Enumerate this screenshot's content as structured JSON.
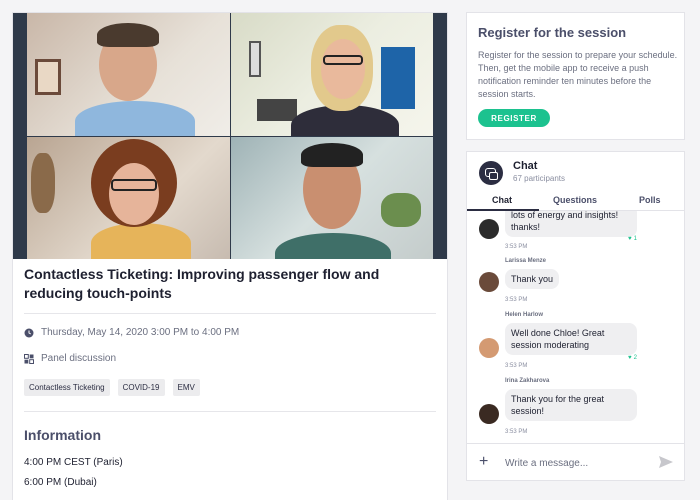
{
  "session": {
    "title": "Contactless Ticketing: Improving passenger flow and reducing touch-points",
    "date": "Thursday, May 14, 2020 3:00 PM to 4:00 PM",
    "format": "Panel discussion",
    "tags": [
      "Contactless Ticketing",
      "COVID-19",
      "EMV"
    ],
    "info_heading": "Information",
    "times": [
      "4:00 PM CEST (Paris)",
      "6:00 PM (Dubai)"
    ]
  },
  "register": {
    "title": "Register for the session",
    "description": "Register for the session to prepare your schedule. Then, get the mobile app to receive a push notification reminder ten minutes before the session starts.",
    "button": "REGISTER"
  },
  "chat": {
    "title": "Chat",
    "participants": "67 participants",
    "tabs": [
      "Chat",
      "Questions",
      "Polls"
    ],
    "messages": [
      {
        "name": "",
        "text": "lots of energy and insights! thanks!",
        "time": "3:53 PM",
        "likes": "1"
      },
      {
        "name": "Larissa Menze",
        "text": "Thank you",
        "time": "3:53 PM",
        "likes": ""
      },
      {
        "name": "Helen Harlow",
        "text": "Well done Chloe! Great session moderating",
        "time": "3:53 PM",
        "likes": "2"
      },
      {
        "name": "Irina Zakharova",
        "text": "Thank you for the great session!",
        "time": "3:53 PM",
        "likes": ""
      }
    ],
    "composer_placeholder": "Write a message..."
  },
  "colors": {
    "accent": "#1cc28f",
    "video_bg": "#2f3a4a",
    "heading": "#4b4f6a"
  },
  "icons": {
    "date": "clock-icon",
    "format": "grid-icon",
    "chat": "chat-bubbles-icon",
    "like": "heart-icon",
    "add": "plus-icon",
    "send": "send-icon"
  }
}
